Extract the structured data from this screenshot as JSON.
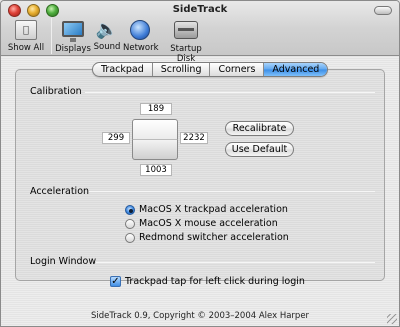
{
  "window": {
    "title": "SideTrack"
  },
  "toolbar": {
    "items": [
      {
        "label": "Show All",
        "icon": "apple-grid-icon"
      },
      {
        "label": "Displays",
        "icon": "display-icon"
      },
      {
        "label": "Sound",
        "icon": "speaker-icon"
      },
      {
        "label": "Network",
        "icon": "globe-icon"
      },
      {
        "label": "Startup Disk",
        "icon": "hard-disk-icon"
      }
    ]
  },
  "tabs": [
    {
      "label": "Trackpad",
      "active": false
    },
    {
      "label": "Scrolling",
      "active": false
    },
    {
      "label": "Corners",
      "active": false
    },
    {
      "label": "Advanced",
      "active": true
    }
  ],
  "calibration": {
    "heading": "Calibration",
    "top": "189",
    "left": "299",
    "right": "2232",
    "bottom": "1003",
    "recalibrate_label": "Recalibrate",
    "use_default_label": "Use Default"
  },
  "acceleration": {
    "heading": "Acceleration",
    "options": [
      {
        "label": "MacOS X trackpad acceleration",
        "selected": true
      },
      {
        "label": "MacOS X mouse acceleration",
        "selected": false
      },
      {
        "label": "Redmond switcher acceleration",
        "selected": false
      }
    ]
  },
  "login_window": {
    "heading": "Login Window",
    "checkbox_label": "Trackpad tap for left click during login",
    "checked": true
  },
  "footer": {
    "text": "SideTrack 0.9, Copyright © 2003–2004 Alex Harper"
  },
  "colors": {
    "accent": "#3b8de6",
    "selected_tab": "#5ea6ef"
  }
}
